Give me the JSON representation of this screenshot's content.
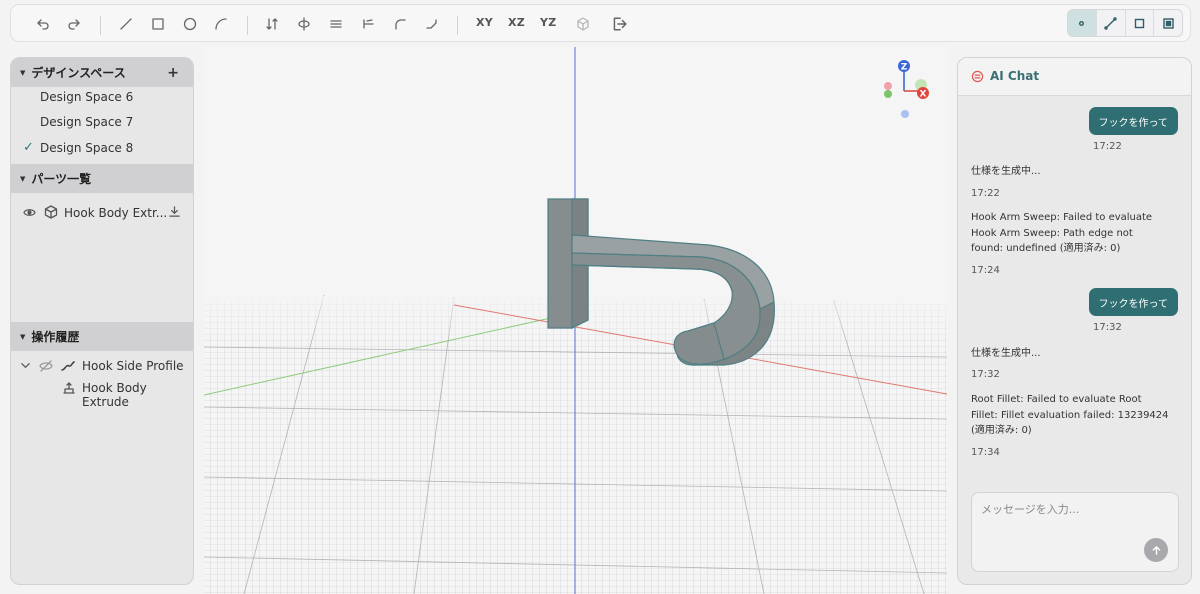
{
  "toolbar": {
    "icons": [
      "undo-icon",
      "redo-icon",
      "line-icon",
      "rectangle-icon",
      "circle-icon",
      "arc-icon",
      "extrude-icon",
      "revolve-icon",
      "sweep-icon",
      "trim-icon",
      "fillet-icon",
      "chamfer-icon",
      "view-icon",
      "export-icon"
    ],
    "plane_xy": "XY",
    "plane_xz": "XZ",
    "plane_yz": "YZ",
    "modes": [
      "point-mode",
      "edge-mode",
      "face-mode",
      "body-mode"
    ],
    "active_mode": "point-mode"
  },
  "design_space": {
    "title": "デザインスペース",
    "add": "+",
    "items": [
      {
        "label": "Design Space 6",
        "selected": false
      },
      {
        "label": "Design Space 7",
        "selected": false
      },
      {
        "label": "Design Space 8",
        "selected": true
      }
    ]
  },
  "parts": {
    "title": "パーツ一覧",
    "items": [
      {
        "label": "Hook Body Extr..."
      }
    ]
  },
  "history": {
    "title": "操作履歴",
    "items": [
      {
        "label": "Hook Side Profile"
      },
      {
        "label": "Hook Body Extrude"
      }
    ]
  },
  "viewport": {
    "axis_z": "Z",
    "axis_x": "X",
    "colors": {
      "z_axis": "#3b67d6",
      "x_axis": "#e0443c",
      "y_axis": "#7cc46a",
      "model": "#8e9596"
    }
  },
  "chat": {
    "title": "AI Chat",
    "messages": [
      {
        "role": "user",
        "text": "フックを作って",
        "time": "17:22"
      },
      {
        "role": "assistant",
        "lines": [
          "仕様を生成中..."
        ],
        "time": "17:22"
      },
      {
        "role": "assistant",
        "lines": [
          "Hook Arm Sweep: Failed to evaluate",
          "Hook Arm Sweep: Path edge not",
          "found: undefined (適用済み: 0)"
        ],
        "time": "17:24"
      },
      {
        "role": "user",
        "text": "フックを作って",
        "time": "17:32"
      },
      {
        "role": "assistant",
        "lines": [
          "仕様を生成中..."
        ],
        "time": "17:32"
      },
      {
        "role": "assistant",
        "lines": [
          "Root Fillet: Failed to evaluate Root",
          "Fillet: Fillet evaluation failed: 13239424",
          "(適用済み: 0)"
        ],
        "time": "17:34"
      }
    ],
    "input_placeholder": "メッセージを入力...",
    "accent": "#2f6f73"
  }
}
